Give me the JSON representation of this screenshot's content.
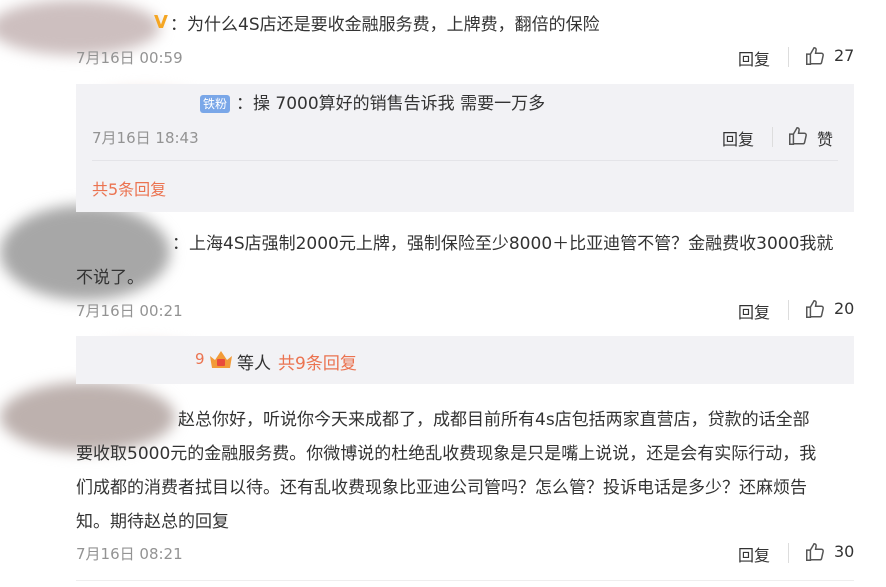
{
  "comments": [
    {
      "text": "：为什么4S店还是要收金融服务费，上牌费，翻倍的保险",
      "time": "7月16日 00:59",
      "reply": "回复",
      "likes": "27"
    },
    {
      "text": "：上海4S店强制2000元上牌，强制保险至少8000＋比亚迪管不管？金融费收3000我就",
      "text2": "不说了。",
      "time": "7月16日 00:21",
      "reply": "回复",
      "likes": "20"
    },
    {
      "lines": [
        "赵总你好，听说你今天来成都了，成都目前所有4s店包括两家直营店，贷款的话全部",
        "要收取5000元的金融服务费。你微博说的杜绝乱收费现象是只是嘴上说说，还是会有实际行动，我",
        "们成都的消费者拭目以待。还有乱收费现象比亚迪公司管吗？怎么管？投诉电话是多少？还麻烦告",
        "知。期待赵总的回复"
      ],
      "time": "7月16日 08:21",
      "reply": "回复",
      "likes": "30"
    }
  ],
  "sub_reply": {
    "badge": "铁粉",
    "text": "：操 7000算好的销售告诉我 需要一万多",
    "time": "7月16日 18:43",
    "reply": "回复",
    "likes": "赞",
    "more": "共5条回复"
  },
  "second_sub": {
    "badge_char": "9",
    "label": "等人",
    "more": "共9条回复"
  },
  "icons": {
    "like": "thumbs-up-icon",
    "vip": "vip-v-icon",
    "crown": "crown-badge-icon"
  },
  "colors": {
    "link": "#eb7350",
    "fan_badge": "#7aa7e8",
    "sub_bg": "#f2f2f5"
  }
}
